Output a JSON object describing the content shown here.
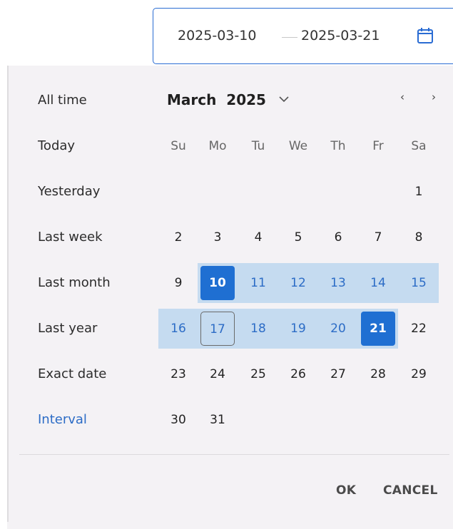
{
  "range": {
    "start": "2025-03-10",
    "end": "2025-03-21",
    "icon": "calendar-icon"
  },
  "presets": [
    {
      "label": "All time"
    },
    {
      "label": "Today"
    },
    {
      "label": "Yesterday"
    },
    {
      "label": "Last week"
    },
    {
      "label": "Last month"
    },
    {
      "label": "Last year"
    },
    {
      "label": "Exact date"
    },
    {
      "label": "Interval"
    }
  ],
  "active_preset": "Interval",
  "calendar": {
    "month": "March",
    "year": "2025",
    "prev_label": "‹",
    "next_label": "›",
    "weekdays": [
      "Su",
      "Mo",
      "Tu",
      "We",
      "Th",
      "Fr",
      "Sa"
    ],
    "days": [
      "1",
      "2",
      "3",
      "4",
      "5",
      "6",
      "7",
      "8",
      "9",
      "10",
      "11",
      "12",
      "13",
      "14",
      "15",
      "16",
      "17",
      "18",
      "19",
      "20",
      "21",
      "22",
      "23",
      "24",
      "25",
      "26",
      "27",
      "28",
      "29",
      "30",
      "31"
    ],
    "first_weekday": "Sa",
    "selected_start": "10",
    "selected_end": "21",
    "today": "17"
  },
  "footer": {
    "ok_label": "OK",
    "cancel_label": "CANCEL"
  },
  "colors": {
    "accent": "#1f6fd2",
    "range_fill": "#c5dbf0",
    "panel_bg": "#f4f2f5",
    "link": "#2c6cc6"
  }
}
